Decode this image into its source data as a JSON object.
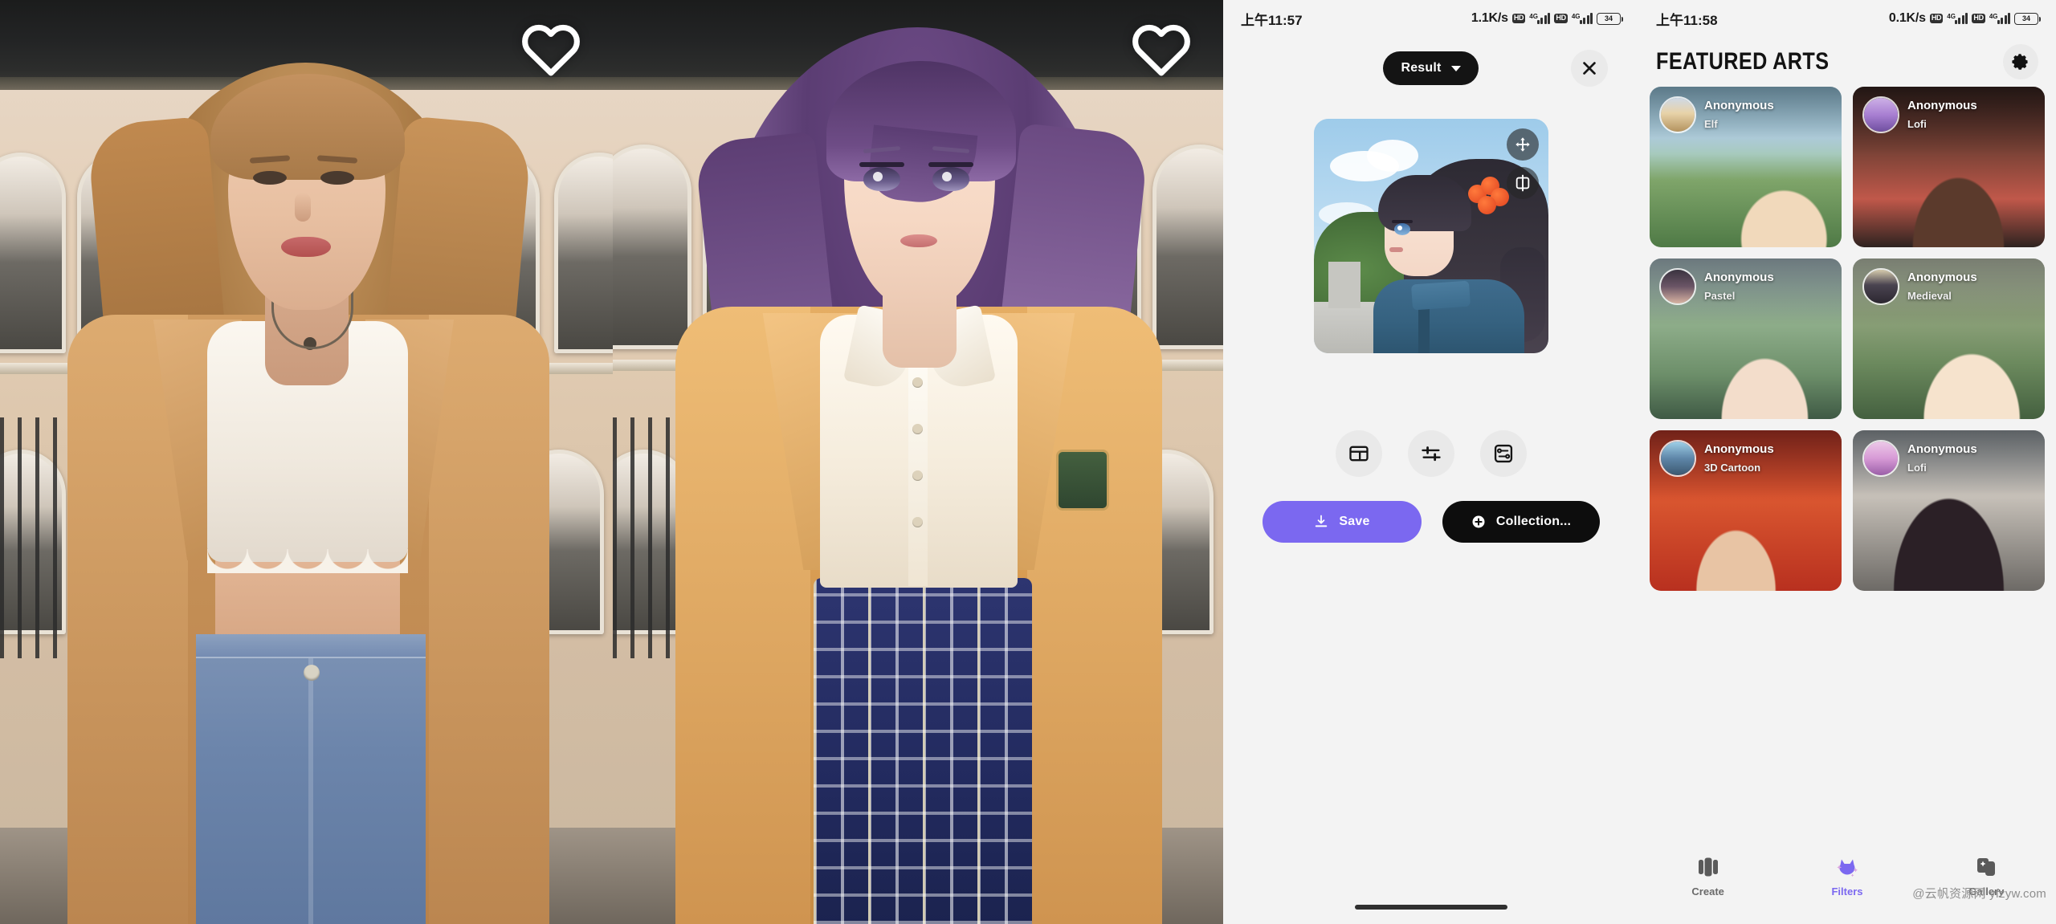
{
  "left_photos": [
    {
      "name": "original-photo",
      "favorite_icon": "heart-icon"
    },
    {
      "name": "anime-stylized-photo",
      "favorite_icon": "heart-icon"
    }
  ],
  "editor": {
    "status_bar": {
      "time": "上午11:57",
      "network_speed": "1.1K/s",
      "hd_badge_1": "HD",
      "network_type_1": "4G",
      "hd_badge_2": "HD",
      "network_type_2": "4G",
      "battery": "34"
    },
    "mode_button": {
      "label": "Result",
      "icon": "chevron-down-icon"
    },
    "close_icon": "close-icon",
    "preview": {
      "move_icon": "move-arrows-icon",
      "compare_icon": "compare-split-icon"
    },
    "tools": [
      {
        "name": "layout-tool",
        "icon": "layout-collage-icon"
      },
      {
        "name": "adjust-tool",
        "icon": "sliders-icon"
      },
      {
        "name": "settings-tool",
        "icon": "framed-settings-icon"
      }
    ],
    "actions": {
      "save": {
        "label": "Save",
        "icon": "download-icon",
        "color": "#7b68f0"
      },
      "collection": {
        "label": "Collection...",
        "icon": "plus-circle-icon",
        "color": "#0d0d0d"
      }
    }
  },
  "gallery": {
    "status_bar": {
      "time": "上午11:58",
      "network_speed": "0.1K/s",
      "hd_badge_1": "HD",
      "network_type_1": "4G",
      "hd_badge_2": "HD",
      "network_type_2": "4G",
      "battery": "34"
    },
    "header": {
      "title": "FEATURED ARTS",
      "settings_icon": "gear-icon"
    },
    "cards": [
      {
        "user": "Anonymous",
        "style": "Elf",
        "art_class": "art-elf",
        "avatar_class": "av-elf"
      },
      {
        "user": "Anonymous",
        "style": "Lofi",
        "art_class": "art-lofi1",
        "avatar_class": "av-lofi1"
      },
      {
        "user": "Anonymous",
        "style": "Pastel",
        "art_class": "art-pastel",
        "avatar_class": "av-pastel"
      },
      {
        "user": "Anonymous",
        "style": "Medieval",
        "art_class": "art-medieval",
        "avatar_class": "av-medieval"
      },
      {
        "user": "Anonymous",
        "style": "3D Cartoon",
        "art_class": "art-3d",
        "avatar_class": "av-3d"
      },
      {
        "user": "Anonymous",
        "style": "Lofi",
        "art_class": "art-lofi2",
        "avatar_class": "av-lofi2"
      }
    ],
    "bottom_nav": [
      {
        "label": "Create",
        "icon": "cards-stack-icon",
        "active": false
      },
      {
        "label": "Filters",
        "icon": "cat-sparkle-icon",
        "active": true
      },
      {
        "label": "Gallery",
        "icon": "photo-stack-icon",
        "active": false
      }
    ],
    "watermark": "@云帆资源网 yfzyw.com",
    "accent_color": "#7b68f0"
  }
}
